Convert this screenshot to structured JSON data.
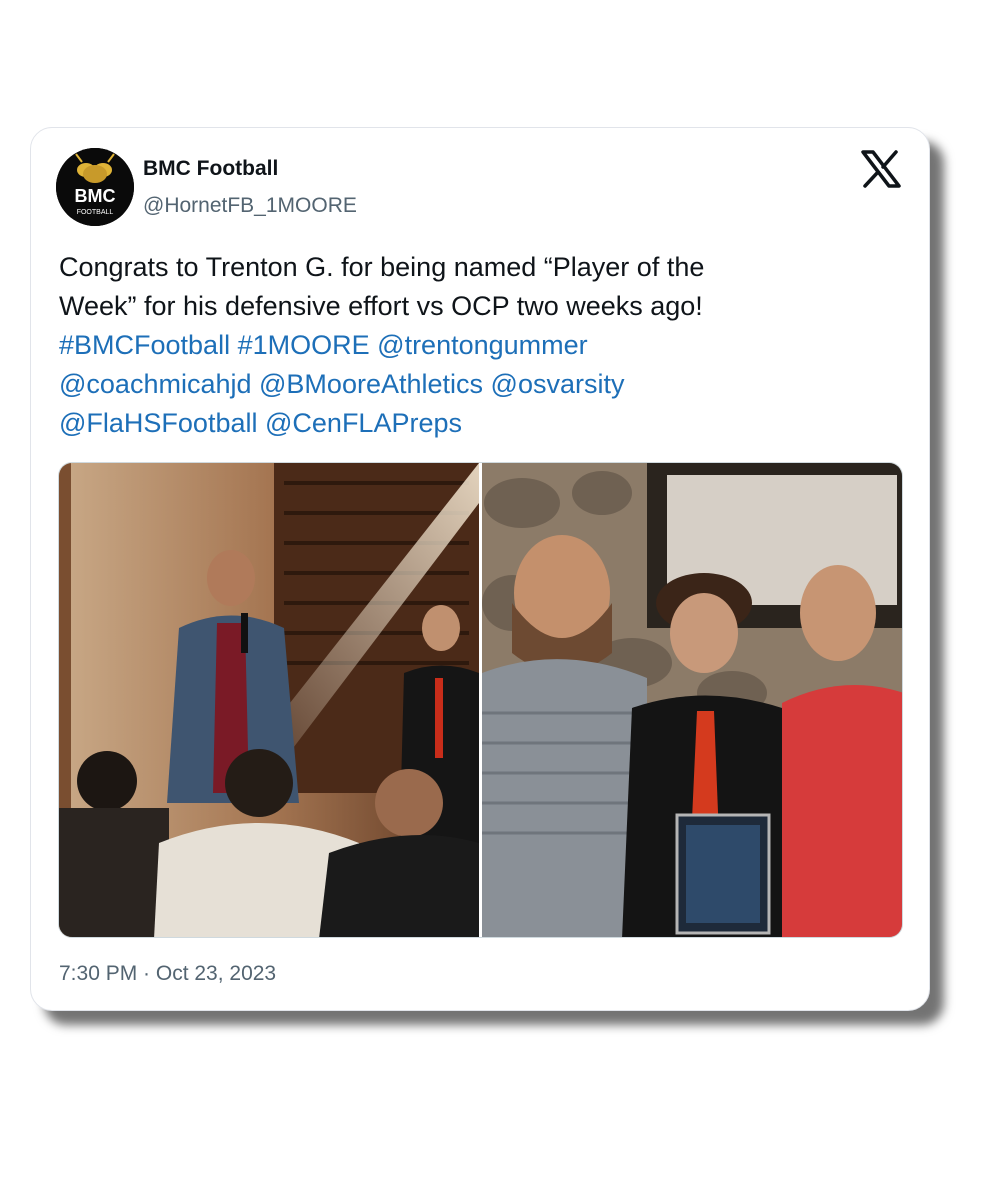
{
  "author": {
    "name": "BMC Football",
    "handle": "@HornetFB_1MOORE",
    "avatar_text": "BMC",
    "avatar_subtext": "FOOTBALL"
  },
  "tweet": {
    "text_line1": "Congrats to Trenton G. for being named “Player of the",
    "text_line2": "Week” for his defensive effort vs OCP two weeks ago!",
    "tags": [
      "#BMCFootball",
      "#1MOORE",
      "@trentongummer",
      "@coachmicahjd",
      "@BMooreAthletics",
      "@osvarsity",
      "@FlaHSFootball",
      "@CenFLAPreps"
    ],
    "timestamp": "7:30 PM · Oct 23, 2023"
  },
  "photos": {
    "left_icon": "photo-speaker-at-podium",
    "right_icon": "photo-award-plaque-group"
  },
  "icons": {
    "platform_logo": "x-logo-icon"
  },
  "colors": {
    "link": "#1d6fb8",
    "text": "#0f1419",
    "secondary": "#536471"
  }
}
